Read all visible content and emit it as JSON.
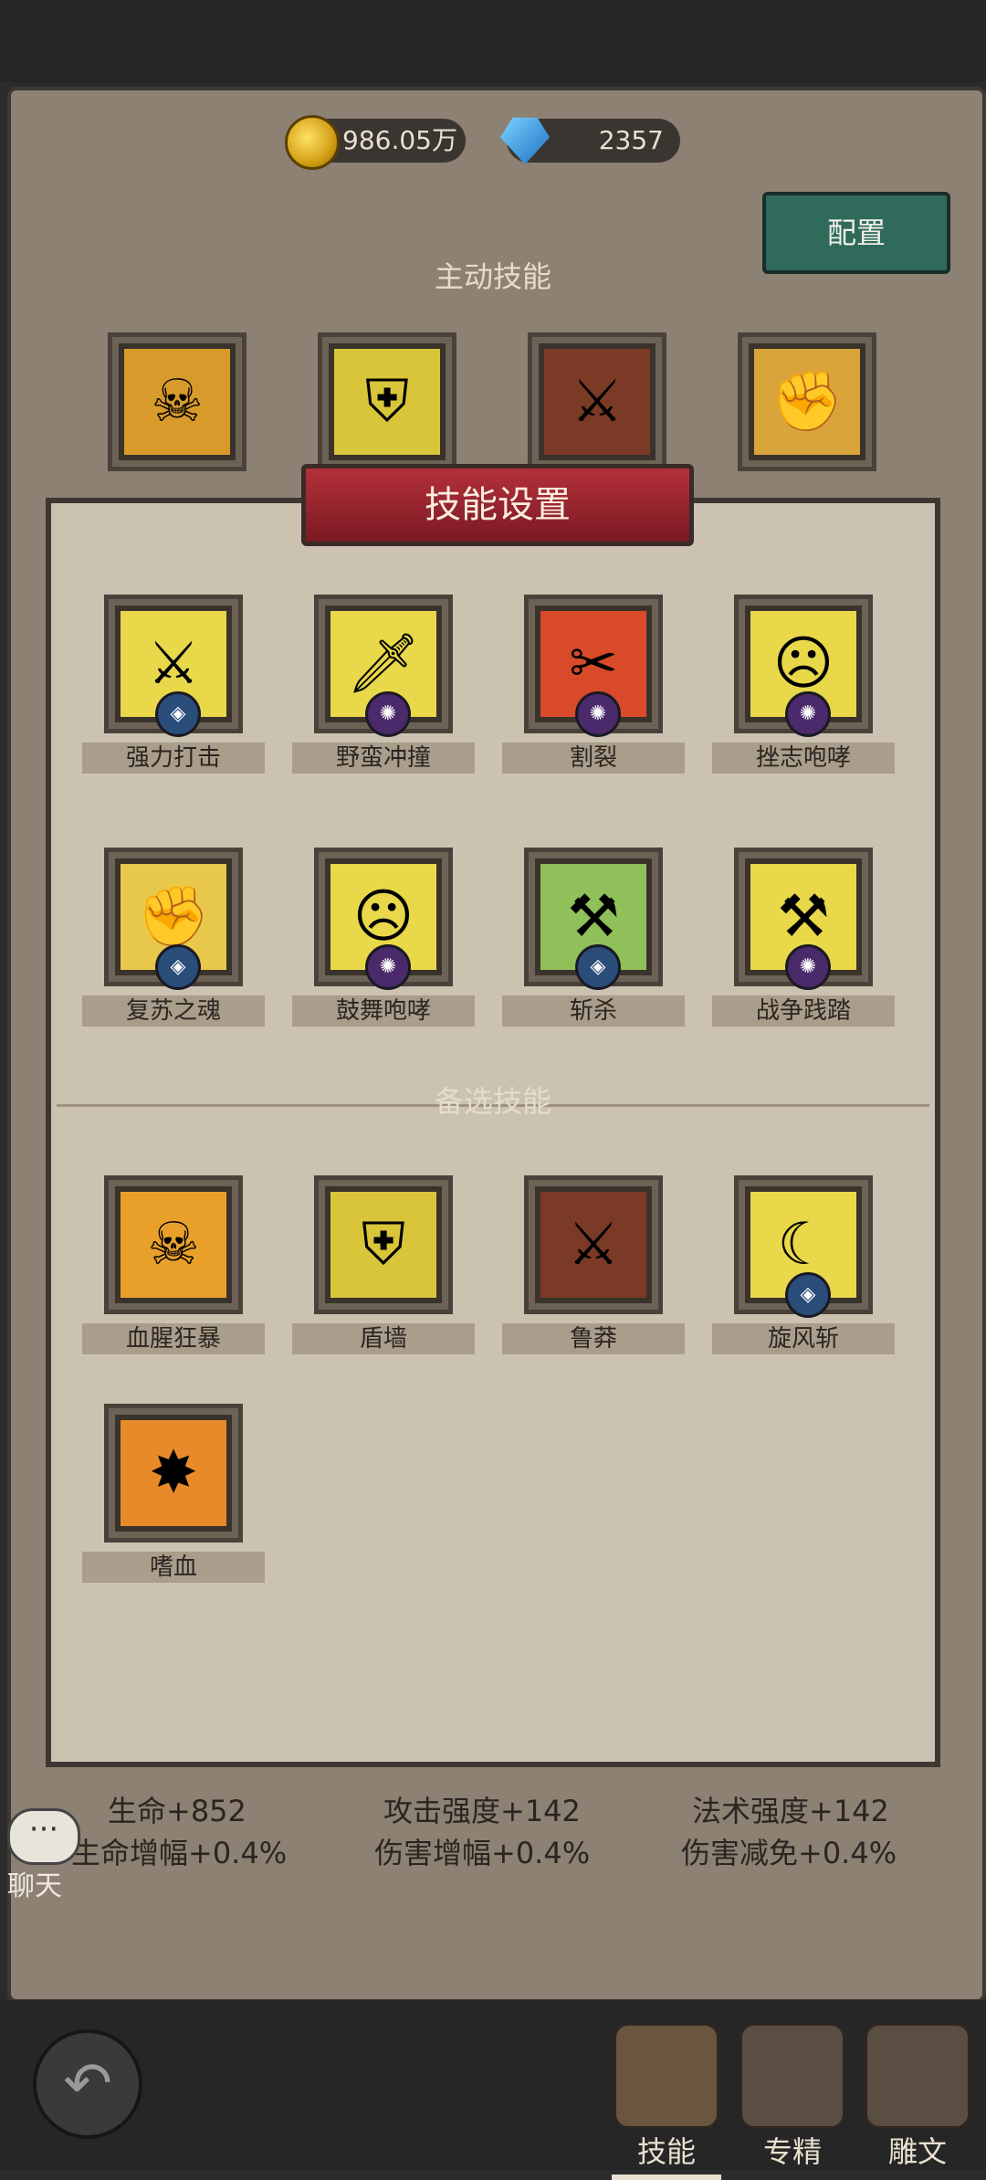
{
  "currency": {
    "gold": "986.05万",
    "gems": "2357"
  },
  "config_button": "配置",
  "active_section_title": "主动技能",
  "dialog_title": "技能设置",
  "colors": {
    "dialog_bg": "#cbc2b1",
    "title_red": "#b4303a",
    "config_teal": "#2f6a5a"
  },
  "active_skills": [
    {
      "icon": "skull-icon",
      "bg": "#d89a2a"
    },
    {
      "icon": "shield-icon",
      "bg": "#d9c53a"
    },
    {
      "icon": "claw-icon",
      "bg": "#7a3a26"
    },
    {
      "icon": "muscle-icon",
      "bg": "#d9a43a"
    }
  ],
  "equipped_skills": [
    {
      "name": "强力打击",
      "icon": "blade-strike-icon",
      "rune": "blue",
      "bg": "#e8d84a"
    },
    {
      "name": "野蛮冲撞",
      "icon": "sword-charge-icon",
      "rune": "purple",
      "bg": "#e8d84a"
    },
    {
      "name": "割裂",
      "icon": "slash-icon",
      "rune": "purple",
      "bg": "#d84a2a"
    },
    {
      "name": "挫志咆哮",
      "icon": "roar-icon",
      "rune": "purple",
      "bg": "#e8d84a"
    },
    {
      "name": "复苏之魂",
      "icon": "muscle-icon",
      "rune": "blue",
      "bg": "#e8c84a"
    },
    {
      "name": "鼓舞咆哮",
      "icon": "roar-icon",
      "rune": "purple",
      "bg": "#e8d84a"
    },
    {
      "name": "斩杀",
      "icon": "axe-icon",
      "rune": "blue",
      "bg": "#8fc05a"
    },
    {
      "name": "战争践踏",
      "icon": "hammer-icon",
      "rune": "purple",
      "bg": "#e8d84a"
    }
  ],
  "backup_section_title": "备选技能",
  "backup_skills": [
    {
      "name": "血腥狂暴",
      "icon": "skull-icon",
      "rune": "",
      "bg": "#e8a02a"
    },
    {
      "name": "盾墙",
      "icon": "shield-icon",
      "rune": "",
      "bg": "#d9c53a"
    },
    {
      "name": "鲁莽",
      "icon": "claw-icon",
      "rune": "",
      "bg": "#7a3a26"
    },
    {
      "name": "旋风斩",
      "icon": "whirlwind-icon",
      "rune": "blue",
      "bg": "#e8d84a"
    },
    {
      "name": "嗜血",
      "icon": "bloodlust-icon",
      "rune": "",
      "bg": "#e88a2a"
    }
  ],
  "stats": [
    [
      "生命+852",
      "攻击强度+142",
      "法术强度+142"
    ],
    [
      "生命增幅+0.4%",
      "伤害增幅+0.4%",
      "伤害减免+0.4%"
    ]
  ],
  "chat": {
    "label": "聊天",
    "bubble": "···"
  },
  "nav": [
    {
      "label": "技能",
      "icon": "skill-tab-icon",
      "active": true
    },
    {
      "label": "专精",
      "icon": "specialization-tab-icon",
      "active": false
    },
    {
      "label": "雕文",
      "icon": "glyph-tab-icon",
      "active": false
    }
  ]
}
